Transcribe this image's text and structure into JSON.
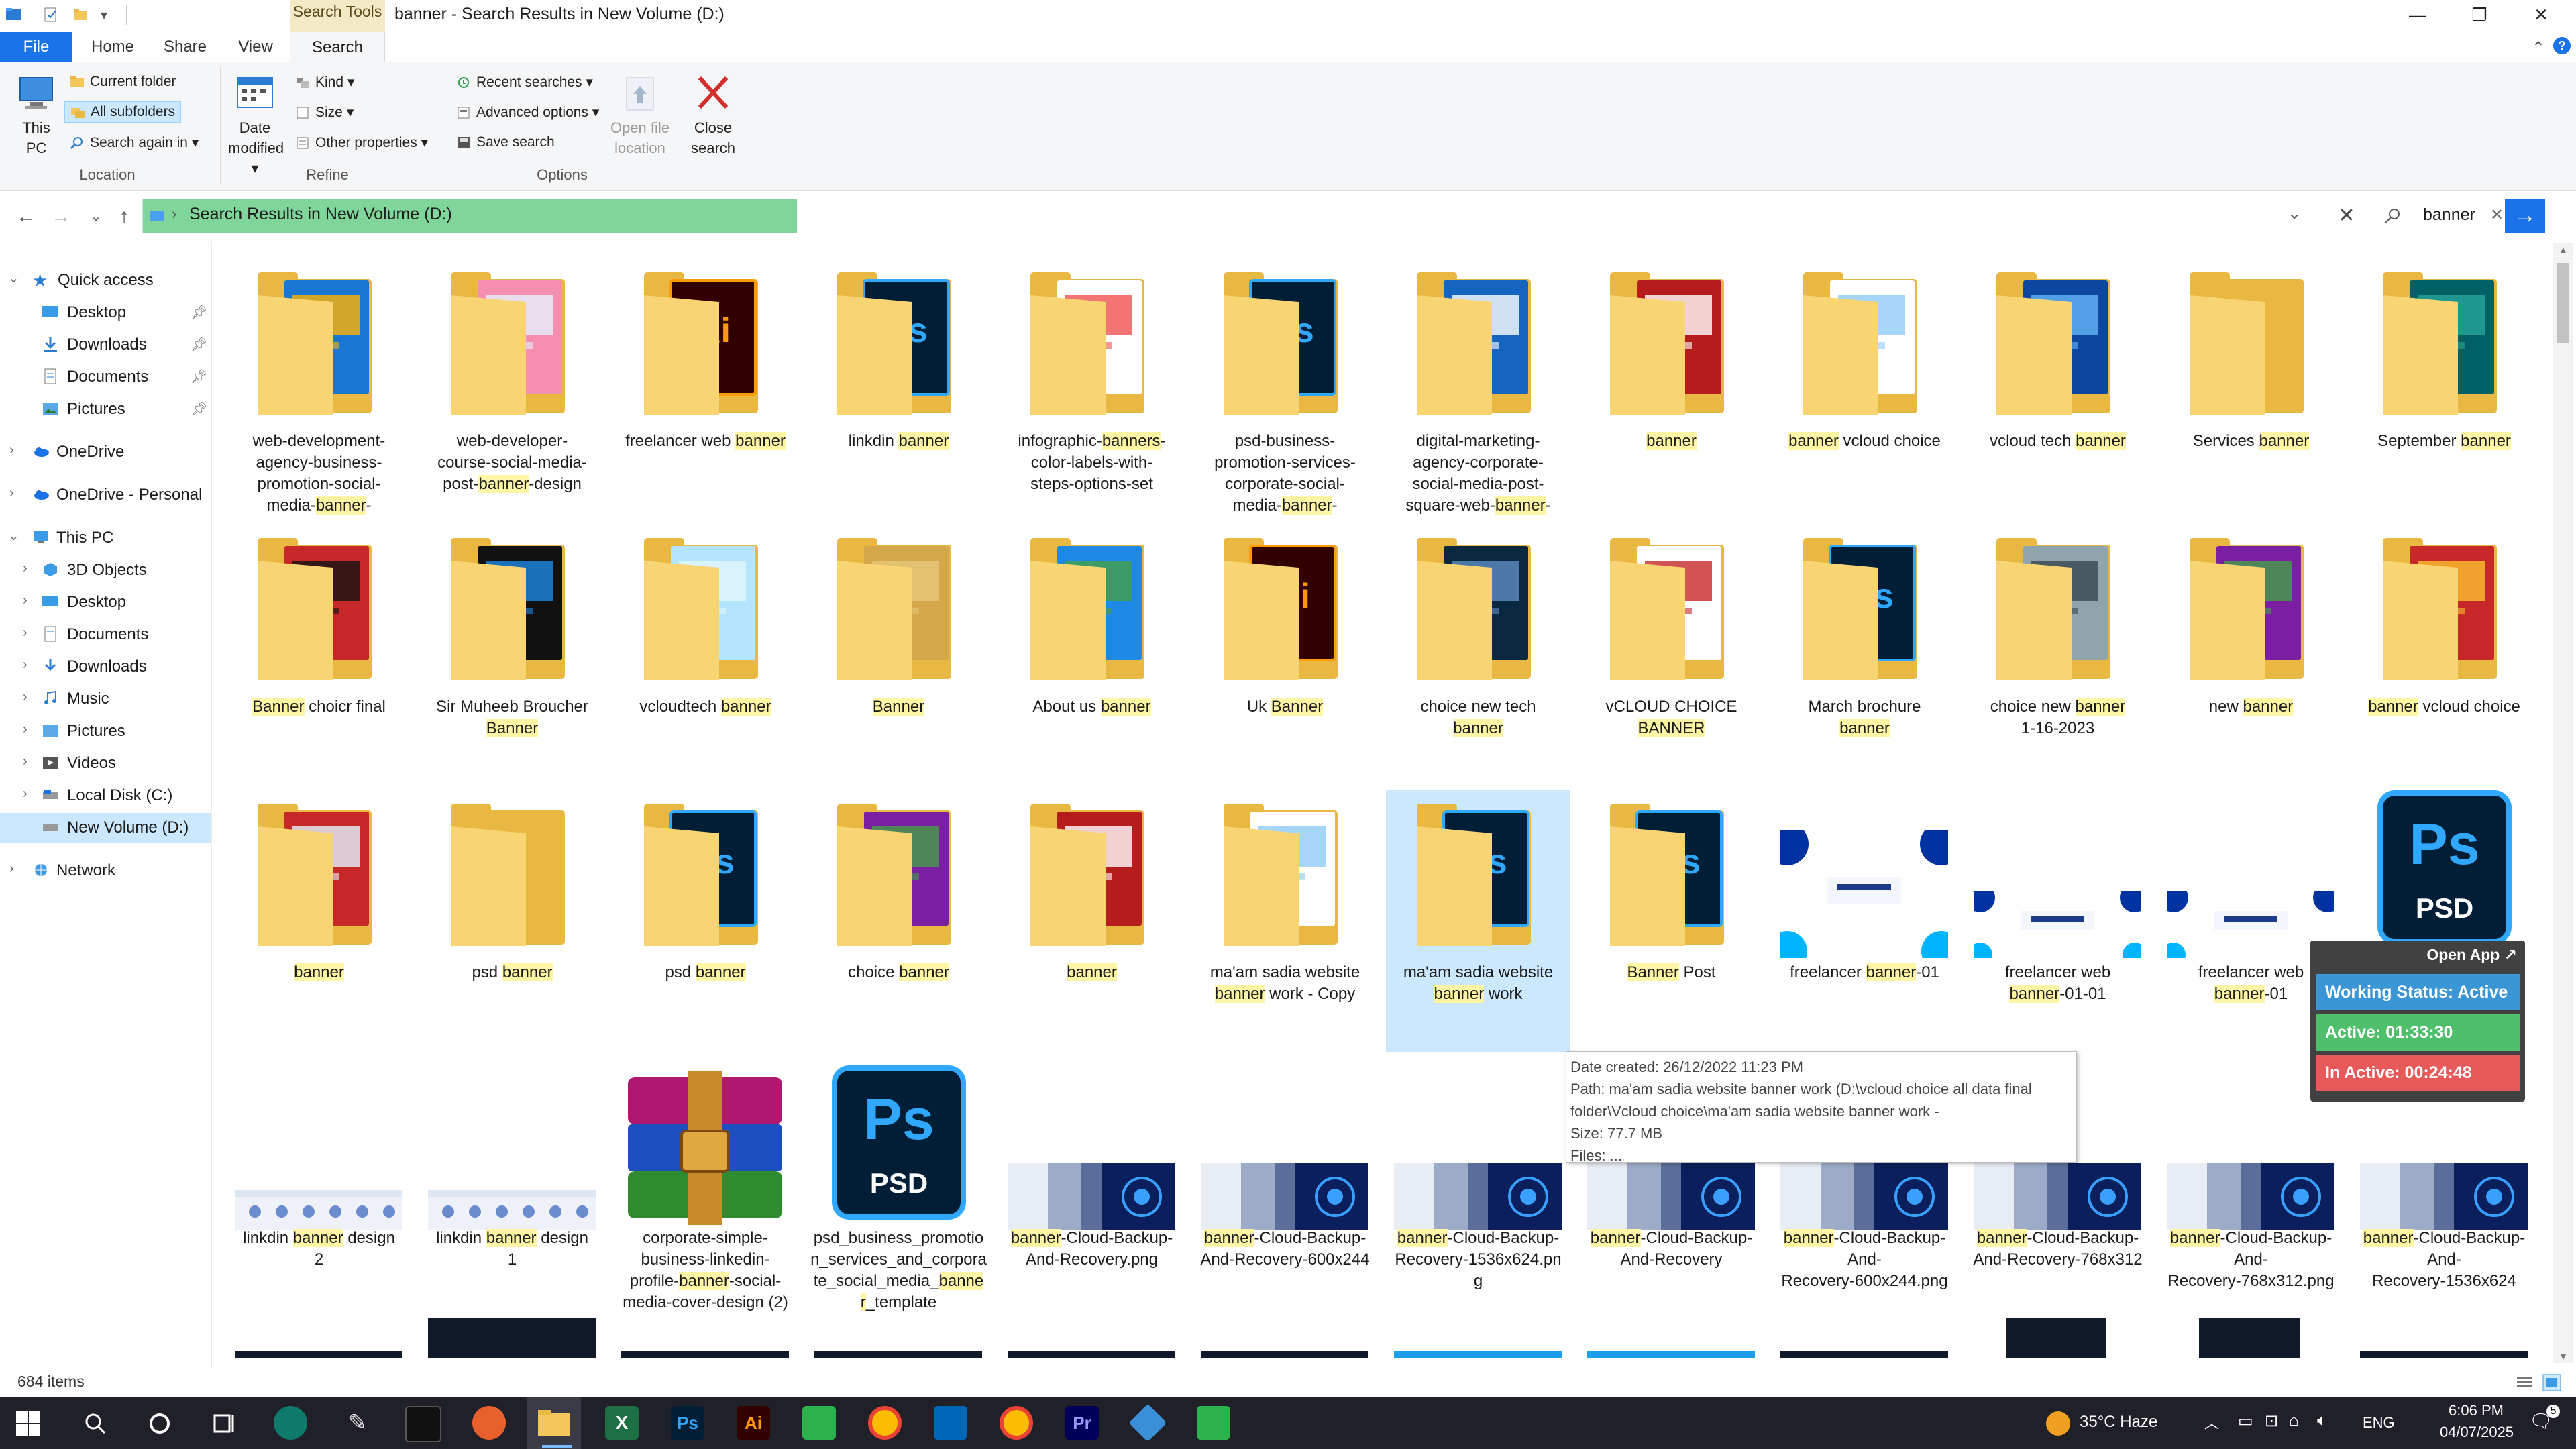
{
  "window": {
    "title": "banner - Search Results in New Volume (D:)",
    "context_tab_group": "Search Tools",
    "controls": [
      "—",
      "❐",
      "✕"
    ]
  },
  "ribbon_tabs": [
    "File",
    "Home",
    "Share",
    "View",
    "Search"
  ],
  "ribbon": {
    "location": {
      "label": "Location",
      "this_pc": "This PC",
      "current_folder": "Current folder",
      "all_subfolders": "All subfolders",
      "search_again_in": "Search again in"
    },
    "refine": {
      "label": "Refine",
      "date_modified": "Date modified",
      "kind": "Kind",
      "size": "Size",
      "other_properties": "Other properties"
    },
    "options": {
      "label": "Options",
      "recent_searches": "Recent searches",
      "advanced_options": "Advanced options",
      "save_search": "Save search",
      "open_file_location": "Open file location",
      "close_search": "Close search"
    }
  },
  "address": {
    "path": "Search Results in New Volume (D:)",
    "search_query": "banner"
  },
  "nav_pane": {
    "quick_access": "Quick access",
    "quick_items": [
      "Desktop",
      "Downloads",
      "Documents",
      "Pictures"
    ],
    "onedrive": "OneDrive",
    "onedrive_personal": "OneDrive - Personal",
    "this_pc": "This PC",
    "pc_items": [
      "3D Objects",
      "Desktop",
      "Documents",
      "Downloads",
      "Music",
      "Pictures",
      "Videos",
      "Local Disk (C:)",
      "New Volume (D:)"
    ],
    "network": "Network"
  },
  "rows": [
    {
      "items": [
        {
          "lines": [
            [
              "web-development-"
            ],
            [
              "agency-business-"
            ],
            [
              "promotion-social-"
            ],
            [
              "media-",
              "§banner",
              "-"
            ]
          ],
          "kind": "folder",
          "art": "blue-flyer"
        },
        {
          "lines": [
            [
              "web-developer-"
            ],
            [
              "course-social-media-"
            ],
            [
              "post-",
              "§banner",
              "-design"
            ]
          ],
          "kind": "folder",
          "art": "pink"
        },
        {
          "lines": [
            [
              "freelancer web ",
              "§banner"
            ]
          ],
          "kind": "folder",
          "art": "ai"
        },
        {
          "lines": [
            [
              "linkdin ",
              "§banner"
            ]
          ],
          "kind": "folder",
          "art": "ps"
        },
        {
          "lines": [
            [
              "infographic-",
              "§banners",
              "-"
            ],
            [
              "color-labels-with-"
            ],
            [
              "steps-options-set"
            ]
          ],
          "kind": "folder",
          "art": "labels"
        },
        {
          "lines": [
            [
              "psd-business-"
            ],
            [
              "promotion-services-"
            ],
            [
              "corporate-social-"
            ],
            [
              "media-",
              "§banner",
              "-"
            ]
          ],
          "kind": "folder",
          "art": "ps-doc"
        },
        {
          "lines": [
            [
              "digital-marketing-"
            ],
            [
              "agency-corporate-"
            ],
            [
              "social-media-post-"
            ],
            [
              "square-web-",
              "§banner",
              "-"
            ]
          ],
          "kind": "folder",
          "art": "digital"
        },
        {
          "lines": [
            [
              "§banner"
            ]
          ],
          "kind": "folder",
          "art": "red"
        },
        {
          "lines": [
            [
              "§banner",
              " vcloud choice"
            ]
          ],
          "kind": "folder",
          "art": "doc"
        },
        {
          "lines": [
            [
              "vcloud tech ",
              "§banner"
            ]
          ],
          "kind": "folder",
          "art": "tech"
        },
        {
          "lines": [
            [
              "Services ",
              "§banner"
            ]
          ],
          "kind": "folder",
          "art": "none"
        },
        {
          "lines": [
            [
              "September ",
              "§banner"
            ]
          ],
          "kind": "folder",
          "art": "teal"
        }
      ]
    },
    {
      "items": [
        {
          "lines": [
            [
              "§Banner",
              " choicr final"
            ]
          ],
          "kind": "folder",
          "art": "red-dark"
        },
        {
          "lines": [
            [
              "Sir Muheeb Broucher"
            ],
            [
              "§Banner"
            ]
          ],
          "kind": "folder",
          "art": "brochure"
        },
        {
          "lines": [
            [
              "vcloudtech ",
              "§banner"
            ]
          ],
          "kind": "folder",
          "art": "ice"
        },
        {
          "lines": [
            [
              "§Banner"
            ]
          ],
          "kind": "folder",
          "art": "gold"
        },
        {
          "lines": [
            [
              "About us ",
              "§banner"
            ]
          ],
          "kind": "folder",
          "art": "edge"
        },
        {
          "lines": [
            [
              "Uk ",
              "§Banner"
            ]
          ],
          "kind": "folder",
          "art": "ai"
        },
        {
          "lines": [
            [
              "choice new tech"
            ],
            [
              "§banner"
            ]
          ],
          "kind": "folder",
          "art": "darkblue"
        },
        {
          "lines": [
            [
              "vCLOUD CHOICE"
            ],
            [
              "§BANNER"
            ]
          ],
          "kind": "folder",
          "art": "2g"
        },
        {
          "lines": [
            [
              "March brochure"
            ],
            [
              "§banner"
            ]
          ],
          "kind": "folder",
          "art": "ps"
        },
        {
          "lines": [
            [
              "choice new ",
              "§banner"
            ],
            [
              "1-16-2023"
            ]
          ],
          "kind": "folder",
          "art": "people"
        },
        {
          "lines": [
            [
              "new ",
              "§banner"
            ]
          ],
          "kind": "folder",
          "art": "rar"
        },
        {
          "lines": [
            [
              "§banner",
              " vcloud choice"
            ]
          ],
          "kind": "folder",
          "art": "worker"
        }
      ]
    },
    {
      "items": [
        {
          "lines": [
            [
              "§banner"
            ]
          ],
          "kind": "folder",
          "art": "red-flyer"
        },
        {
          "lines": [
            [
              "psd ",
              "§banner"
            ]
          ],
          "kind": "folder",
          "art": "none"
        },
        {
          "lines": [
            [
              "psd ",
              "§banner"
            ]
          ],
          "kind": "folder",
          "art": "ps"
        },
        {
          "lines": [
            [
              "choice ",
              "§banner"
            ]
          ],
          "kind": "folder",
          "art": "rar"
        },
        {
          "lines": [
            [
              "§banner"
            ]
          ],
          "kind": "folder",
          "art": "red"
        },
        {
          "lines": [
            [
              "ma'am sadia website"
            ],
            [
              "§banner",
              " work - Copy"
            ]
          ],
          "kind": "folder",
          "art": "doc"
        },
        {
          "lines": [
            [
              "ma'am sadia website"
            ],
            [
              "§banner",
              " work"
            ]
          ],
          "kind": "folder",
          "art": "ps",
          "selected": true
        },
        {
          "lines": [
            [
              "§Banner",
              " Post"
            ]
          ],
          "kind": "folder",
          "art": "ps"
        },
        {
          "lines": [
            [
              "freelancer ",
              "§banner",
              "-01"
            ]
          ],
          "kind": "image",
          "art": "vartonix-tall"
        },
        {
          "lines": [
            [
              "freelancer web"
            ],
            [
              "§banner",
              "-01-01"
            ]
          ],
          "kind": "image",
          "art": "vartonix"
        },
        {
          "lines": [
            [
              "freelancer web"
            ],
            [
              "§banner",
              "-01"
            ]
          ],
          "kind": "image",
          "art": "vartonix"
        },
        {
          "lines": [
            [
              "linkdin ",
              "§banner"
            ]
          ],
          "kind": "psd",
          "art": "psd"
        }
      ]
    },
    {
      "items": [
        {
          "lines": [
            [
              "linkdin ",
              "§banner",
              " design"
            ],
            [
              "2"
            ]
          ],
          "kind": "image",
          "art": "strip"
        },
        {
          "lines": [
            [
              "linkdin ",
              "§banner",
              " design"
            ],
            [
              "1"
            ]
          ],
          "kind": "image",
          "art": "strip"
        },
        {
          "lines": [
            [
              "corporate-simple-"
            ],
            [
              "business-linkedin-"
            ],
            [
              "profile-",
              "§banner",
              "-social-"
            ],
            [
              "media-cover-design (2)"
            ]
          ],
          "kind": "rar",
          "art": "rar-big"
        },
        {
          "lines": [
            [
              "psd_business_promotio"
            ],
            [
              "n_services_and_corpora"
            ],
            [
              "te_social_media_",
              "§banne"
            ],
            [
              "§r",
              "_template"
            ]
          ],
          "kind": "psd",
          "art": "psd"
        },
        {
          "lines": [
            [
              "§banner",
              "-Cloud-Backup-"
            ],
            [
              "And-Recovery.png"
            ]
          ],
          "kind": "image",
          "art": "cloud"
        },
        {
          "lines": [
            [
              "§banner",
              "-Cloud-Backup-"
            ],
            [
              "And-Recovery-600x244"
            ]
          ],
          "kind": "image",
          "art": "cloud"
        },
        {
          "lines": [
            [
              "§banner",
              "-Cloud-Backup-"
            ],
            [
              "Recovery-1536x624.pn"
            ],
            [
              "g"
            ]
          ],
          "kind": "image",
          "art": "cloud"
        },
        {
          "lines": [
            [
              "§banner",
              "-Cloud-Backup-"
            ],
            [
              "And-Recovery"
            ]
          ],
          "kind": "image",
          "art": "cloud"
        },
        {
          "lines": [
            [
              "§banner",
              "-Cloud-Backup-"
            ],
            [
              "And-"
            ],
            [
              "Recovery-600x244.png"
            ]
          ],
          "kind": "image",
          "art": "cloud"
        },
        {
          "lines": [
            [
              "§banner",
              "-Cloud-Backup-"
            ],
            [
              "And-Recovery-768x312"
            ]
          ],
          "kind": "image",
          "art": "cloud"
        },
        {
          "lines": [
            [
              "§banner",
              "-Cloud-Backup-"
            ],
            [
              "And-"
            ],
            [
              "Recovery-768x312.png"
            ]
          ],
          "kind": "image",
          "art": "cloud"
        },
        {
          "lines": [
            [
              "§banner",
              "-Cloud-Backup-"
            ],
            [
              "And-"
            ],
            [
              "Recovery-1536x624"
            ]
          ],
          "kind": "image",
          "art": "cloud"
        }
      ]
    }
  ],
  "tooltip": {
    "date_created": "Date created: 26/12/2022 11:23 PM",
    "path_line1": "Path: ma'am sadia website banner work (D:\\vcloud choice all data final",
    "path_line2": "folder\\Vcloud choice\\ma'am sadia website banner work -",
    "size": "Size: 77.7 MB",
    "files": "Files: ..."
  },
  "tracker": {
    "open_app": "Open App ↗",
    "working_status": "Working Status: Active",
    "active": "Active: 01:33:30",
    "inactive": "In Active: 00:24:48"
  },
  "status": {
    "items_count": "684 items"
  },
  "taskbar": {
    "weather": "35°C  Haze",
    "language": "ENG",
    "time": "6:06 PM",
    "date": "04/07/2025",
    "notification_badge": "5"
  },
  "colors": {
    "accent": "#1a73e8",
    "address_highlight": "#80d59a",
    "search_tools_tab": "#f3e9c6",
    "folder": "#f3c759",
    "text_highlight": "#fff6a5",
    "selection": "#cce8ff",
    "tracker_active": "#4fbf6b",
    "tracker_inactive": "#e85a5a",
    "tracker_status": "#3b96d6"
  }
}
